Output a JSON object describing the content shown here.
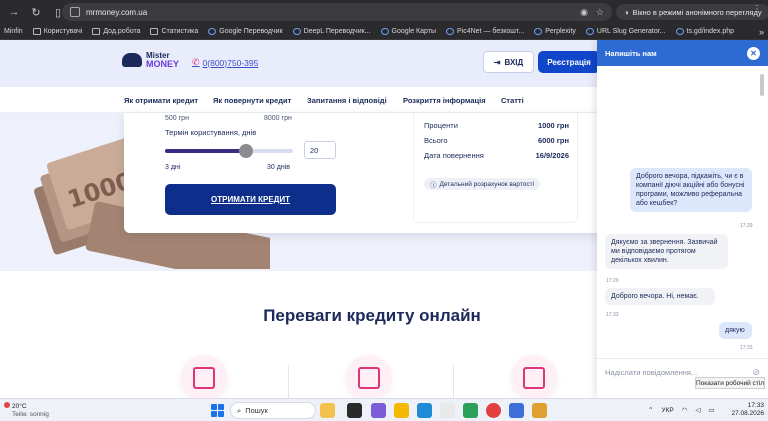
{
  "browser": {
    "url": "mrmoney.com.ua",
    "incognito_label": "Вікно в режимі анонімного перегляду",
    "bookmarks": [
      {
        "label": "Minfin"
      },
      {
        "label": "Користувачі"
      },
      {
        "label": "Дод.робота"
      },
      {
        "label": "Статистика"
      },
      {
        "label": "Google Переводчик"
      },
      {
        "label": "DeepL Переводчик..."
      },
      {
        "label": "Google Карты"
      },
      {
        "label": "Pic4Net — безкошт..."
      },
      {
        "label": "Perplexity"
      },
      {
        "label": "URL Slug Generator..."
      },
      {
        "label": "ts.gd/index.php"
      }
    ]
  },
  "site": {
    "logo": {
      "line1": "Mister",
      "line2": "MONEY"
    },
    "phone": "0(800)750-395",
    "login_label": "ВХІД",
    "register_label": "Реєстрація",
    "nav": [
      "Як отримати кредит",
      "Як повернути кредит",
      "Запитання і відповіді",
      "Розкриття інформація",
      "Статті"
    ],
    "calculator": {
      "amount_min": "500 грн",
      "amount_max": "8000 грн",
      "term_label": "Термін користування, днів",
      "term_min_label": "3 дні",
      "term_max_label": "30 днів",
      "term_value": "20",
      "term_fraction": 0.63,
      "cta_label": "ОТРИМАТИ КРЕДИТ",
      "summary": [
        {
          "label": "Проценти",
          "value": "1000 грн"
        },
        {
          "label": "Всього",
          "value": "6000 грн"
        },
        {
          "label": "Дата повернення",
          "value": "16/9/2026"
        }
      ],
      "details_link": "Детальний розрахунок вартості"
    },
    "benefits_title": "Переваги кредиту онлайн"
  },
  "chat": {
    "title": "Напишіть нам",
    "messages": [
      {
        "direction": "out",
        "text": "Доброго вечора, підкажіть, чи є в компанії діючі акційні або бонусні програми, можливо реферальна або кешбек?",
        "time": "17:29"
      },
      {
        "direction": "in",
        "text": "Дякуємо за звернення. Зазвичай ми відповідаємо протягом декількох хвилин.",
        "time": "17:29"
      },
      {
        "direction": "in",
        "text": "Доброго вечора. Ні, немає.",
        "time": "17:33"
      },
      {
        "direction": "out",
        "text": "дякую",
        "time": "17:33"
      }
    ],
    "input_placeholder": "Надіслати повідомлення...",
    "tooltip": "Показати робочий стіл"
  },
  "taskbar": {
    "weather_temp": "20°C",
    "weather_desc": "Teilw. sonnig",
    "search_label": "Пошук",
    "language": "УКР",
    "time": "17:33",
    "date": "27.08.2026"
  },
  "colors": {
    "brand_navy": "#1b2a5a",
    "brand_blue": "#1046c9",
    "cta_navy": "#0d2f8b",
    "chat_header": "#2d6bd2",
    "accent_pink": "#e0337a"
  }
}
